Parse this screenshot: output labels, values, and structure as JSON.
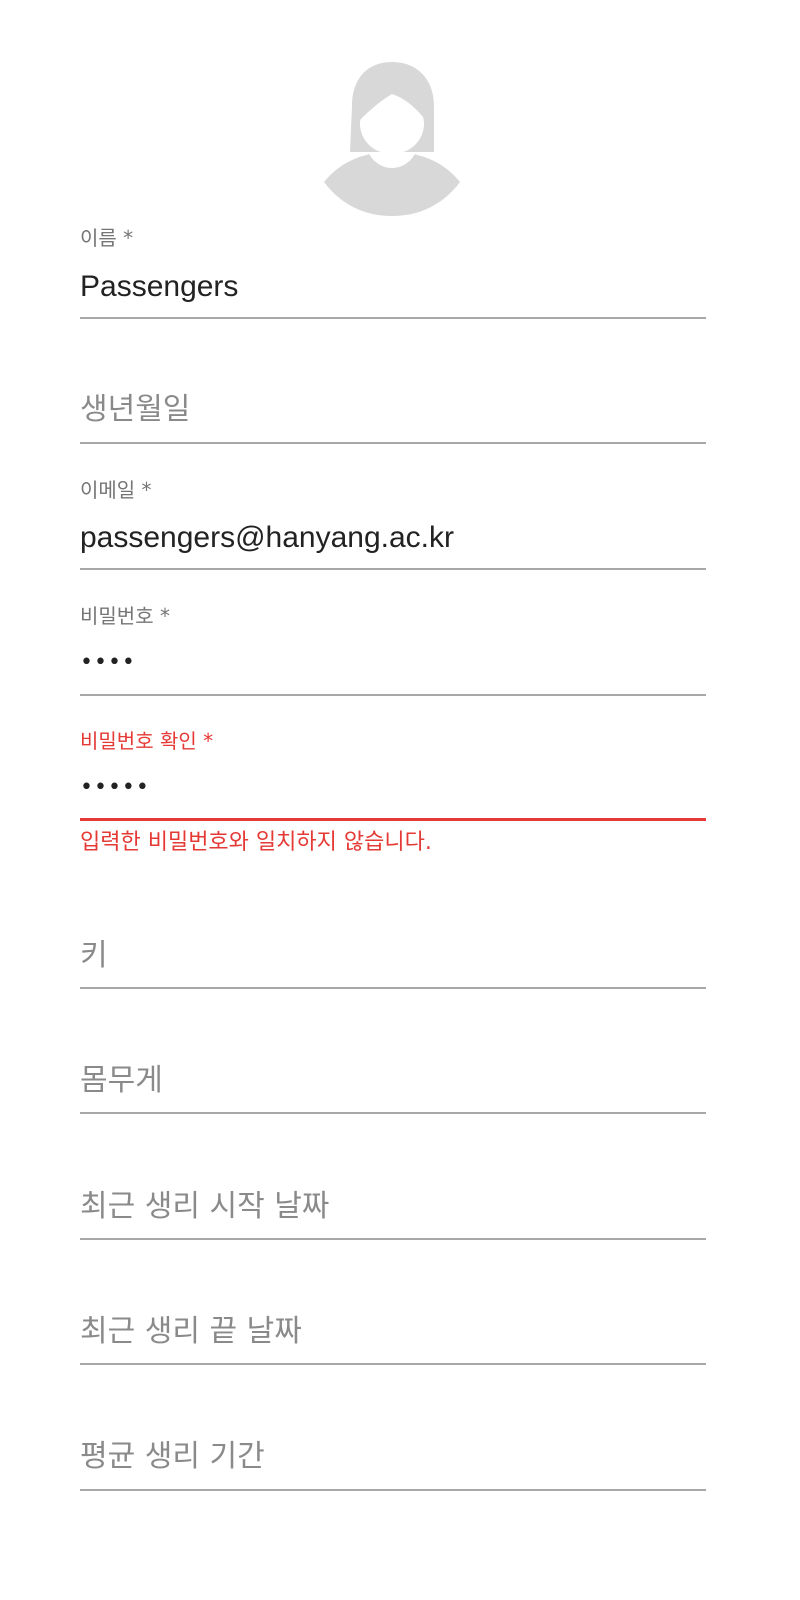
{
  "profile": {
    "avatar_icon": "female-user-avatar-icon",
    "avatar_color": "#d8d8d8"
  },
  "form": {
    "name": {
      "label": "이름 *",
      "value": "Passengers"
    },
    "birthdate": {
      "placeholder": "생년월일"
    },
    "email": {
      "label": "이메일 *",
      "value": "passengers@hanyang.ac.kr"
    },
    "password": {
      "label": "비밀번호 *",
      "masked_value": "••••"
    },
    "password_confirm": {
      "label": "비밀번호 확인 *",
      "masked_value": "•••••",
      "error": "입력한 비밀번호와 일치하지 않습니다."
    },
    "height": {
      "placeholder": "키"
    },
    "weight": {
      "placeholder": "몸무게"
    },
    "last_period_start": {
      "placeholder": "최근 생리 시작 날짜"
    },
    "last_period_end": {
      "placeholder": "최근 생리 끝 날짜"
    },
    "avg_period_length": {
      "placeholder": "평균 생리 기간"
    }
  },
  "colors": {
    "error": "#e53935",
    "underline": "#a8a8a8",
    "label": "#757575",
    "text": "#222222"
  }
}
